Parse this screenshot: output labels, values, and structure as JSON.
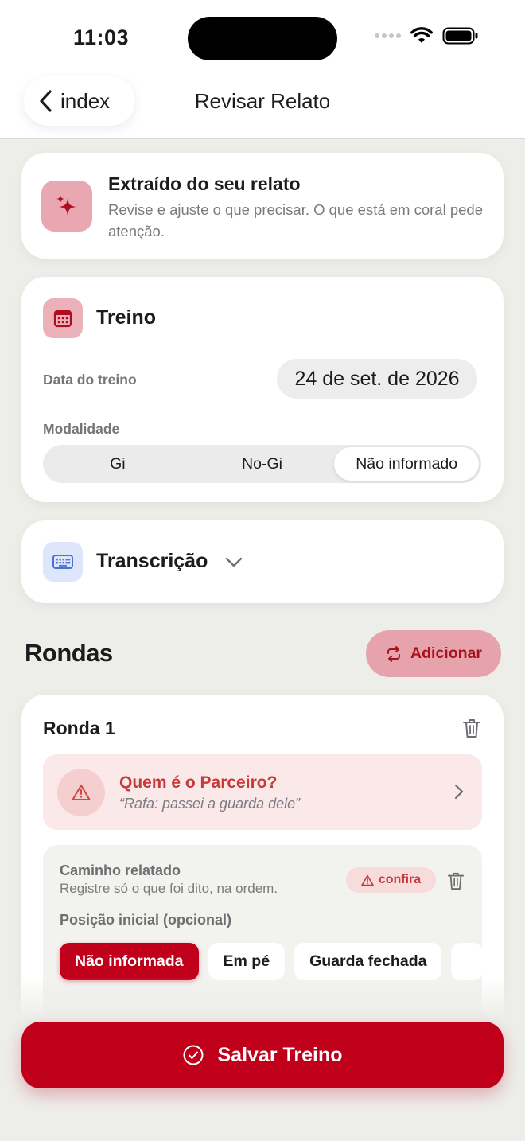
{
  "status_bar": {
    "time": "11:03"
  },
  "nav": {
    "back_label": "index",
    "title": "Revisar Relato"
  },
  "extract_card": {
    "title": "Extraído do seu relato",
    "subtitle": "Revise e ajuste o que precisar. O que está em coral pede atenção.",
    "icon": "sparkles-icon"
  },
  "treino_card": {
    "title": "Treino",
    "icon": "calendar-icon",
    "date_label": "Data do treino",
    "date_value": "24 de set. de 2026",
    "modalidade_label": "Modalidade",
    "modalidade_options": [
      "Gi",
      "No-Gi",
      "Não informado"
    ],
    "modalidade_selected": "Não informado"
  },
  "transcricao_card": {
    "title": "Transcrição",
    "icon": "keyboard-icon",
    "expanded": false
  },
  "rondas": {
    "title": "Rondas",
    "add_label": "Adicionar",
    "items": [
      {
        "title": "Ronda 1",
        "alert": {
          "title": "Quem é o Parceiro?",
          "quote": "“Rafa: passei a guarda dele”"
        },
        "caminho": {
          "title": "Caminho relatado",
          "subtitle": "Registre só o que foi dito, na ordem.",
          "badge": "confira",
          "posicao_label": "Posição inicial (opcional)",
          "posicao_options": [
            "Não informada",
            "Em pé",
            "Guarda fechada"
          ],
          "posicao_selected": "Não informada"
        }
      }
    ]
  },
  "save_label": "Salvar Treino",
  "colors": {
    "brand_red": "#C0001A",
    "coral": "#C73A3A",
    "pink_tint": "#E8A7B1",
    "background": "#EDEDEA"
  }
}
